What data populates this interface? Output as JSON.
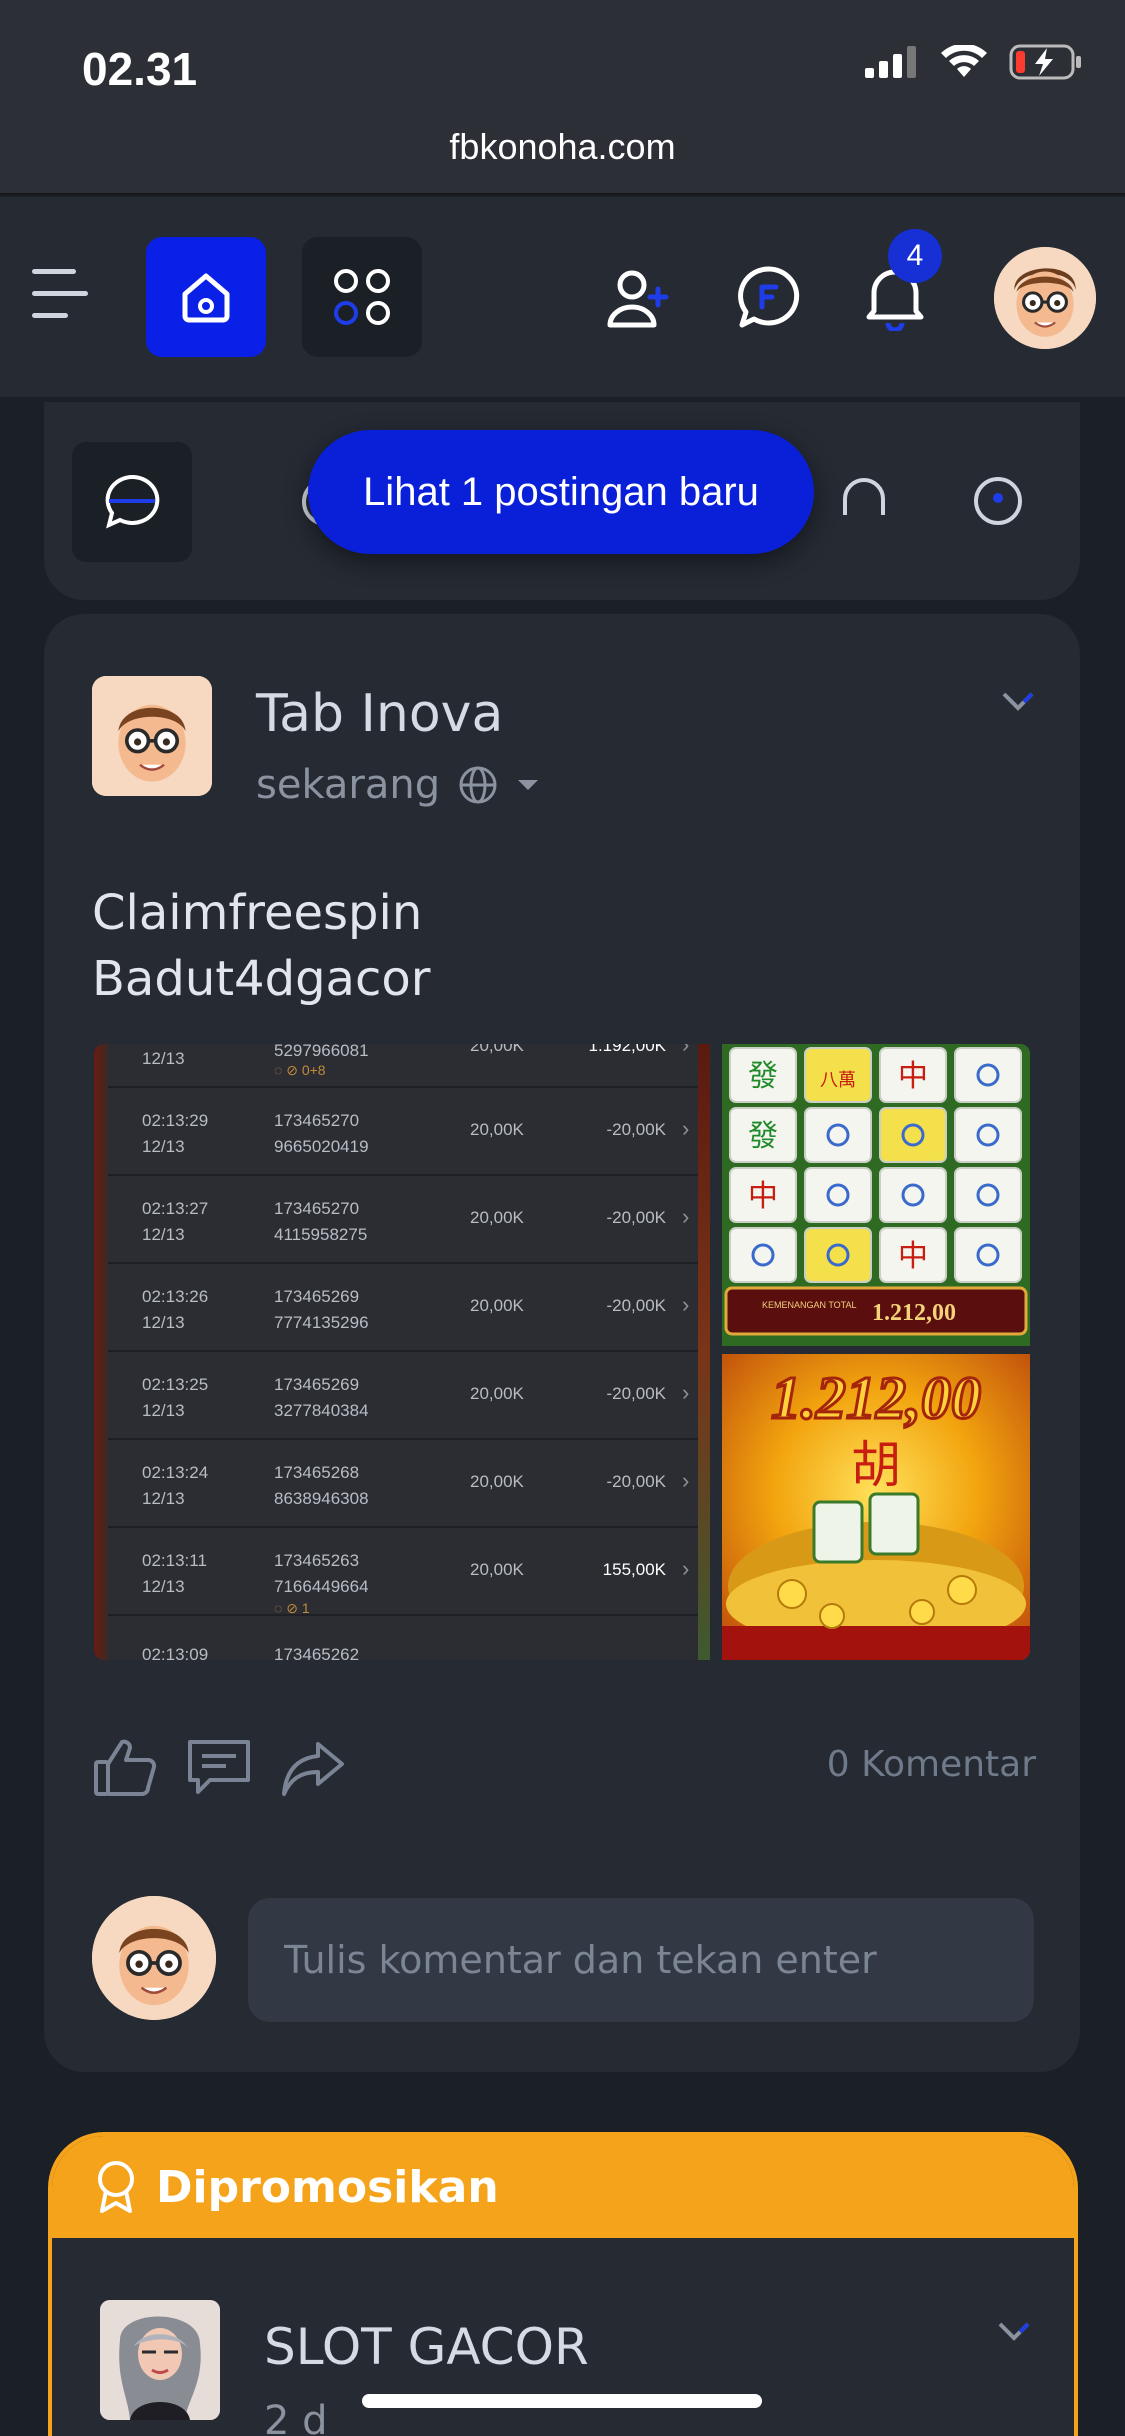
{
  "status_bar": {
    "time": "02.31",
    "url": "fbkonoha.com"
  },
  "header": {
    "notification_count": "4",
    "icons": [
      "menu-icon",
      "home-icon",
      "apps-icon",
      "add-friend-icon",
      "messenger-icon",
      "bell-icon",
      "avatar"
    ]
  },
  "new_post_banner": "Lihat 1 postingan baru",
  "post": {
    "author": "Tab Inova",
    "time": "sekarang",
    "text_line1": "Claimfreespin",
    "text_line2": "Badut4dgacor",
    "comment_count": "0 Komentar",
    "comment_placeholder": "Tulis komentar dan tekan enter",
    "history": [
      {
        "t1": "",
        "t2": "12/13",
        "id1": "5297966081",
        "id2": "",
        "bet": "20,00K",
        "win": "1.192,00K",
        "extra": "0+8"
      },
      {
        "t1": "02:13:29",
        "t2": "12/13",
        "id1": "173465270",
        "id2": "9665020419",
        "bet": "20,00K",
        "win": "-20,00K",
        "extra": ""
      },
      {
        "t1": "02:13:27",
        "t2": "12/13",
        "id1": "173465270",
        "id2": "4115958275",
        "bet": "20,00K",
        "win": "-20,00K",
        "extra": ""
      },
      {
        "t1": "02:13:26",
        "t2": "12/13",
        "id1": "173465269",
        "id2": "7774135296",
        "bet": "20,00K",
        "win": "-20,00K",
        "extra": ""
      },
      {
        "t1": "02:13:25",
        "t2": "12/13",
        "id1": "173465269",
        "id2": "3277840384",
        "bet": "20,00K",
        "win": "-20,00K",
        "extra": ""
      },
      {
        "t1": "02:13:24",
        "t2": "12/13",
        "id1": "173465268",
        "id2": "8638946308",
        "bet": "20,00K",
        "win": "-20,00K",
        "extra": ""
      },
      {
        "t1": "02:13:11",
        "t2": "12/13",
        "id1": "173465263",
        "id2": "7166449664",
        "bet": "20,00K",
        "win": "155,00K",
        "extra": "1"
      },
      {
        "t1": "02:13:09",
        "t2": "",
        "id1": "173465262",
        "id2": "",
        "bet": "",
        "win": "",
        "extra": ""
      }
    ],
    "slot_total_label": "KEMENANGAN TOTAL",
    "slot_total_value": "1.212,00",
    "slot_big_win": "1.212,00",
    "slot_big_glyph": "胡",
    "mahjong_tiles": [
      "發",
      "八萬",
      "中",
      "",
      "發",
      "",
      "",
      "",
      "中",
      "",
      "",
      "",
      "",
      "",
      "中",
      ""
    ]
  },
  "promoted": {
    "label": "Dipromosikan",
    "name": "SLOT GACOR",
    "time": "2 d"
  },
  "colors": {
    "accent_blue": "#0a20e6",
    "promo_orange": "#f5a31a",
    "card_bg": "#252a33",
    "page_bg": "#1b1f26"
  }
}
